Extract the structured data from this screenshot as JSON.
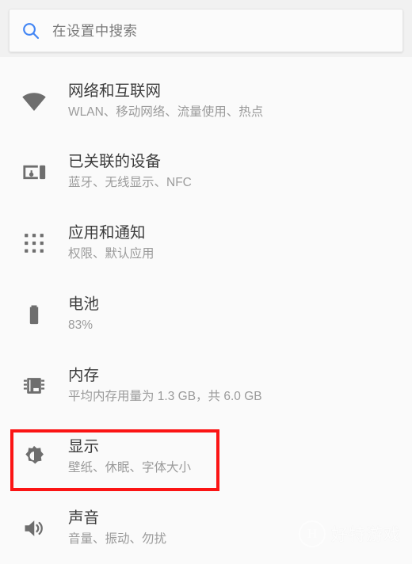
{
  "search": {
    "placeholder": "在设置中搜索",
    "icon": "search-icon",
    "icon_color": "#4285f4"
  },
  "settings_list": [
    {
      "id": "network",
      "icon": "wifi-icon",
      "title": "网络和互联网",
      "subtitle": "WLAN、移动网络、流量使用、热点"
    },
    {
      "id": "devices",
      "icon": "connected-devices-icon",
      "title": "已关联的设备",
      "subtitle": "蓝牙、无线显示、NFC"
    },
    {
      "id": "apps",
      "icon": "apps-grid-icon",
      "title": "应用和通知",
      "subtitle": "权限、默认应用"
    },
    {
      "id": "battery",
      "icon": "battery-icon",
      "title": "电池",
      "subtitle": "83%"
    },
    {
      "id": "memory",
      "icon": "memory-chip-icon",
      "title": "内存",
      "subtitle": "平均内存用量为 1.3 GB，共 6.0 GB"
    },
    {
      "id": "display",
      "icon": "brightness-icon",
      "title": "显示",
      "subtitle": "壁纸、休眠、字体大小"
    },
    {
      "id": "sound",
      "icon": "speaker-icon",
      "title": "声音",
      "subtitle": "音量、振动、勿扰"
    }
  ],
  "annotation": {
    "target": "display",
    "color": "#fb1414",
    "shape": "rectangle"
  },
  "watermark": {
    "logo_letter": "H",
    "text": "好特游戏"
  },
  "colors": {
    "background": "#fafafa",
    "search_background": "#f1f1f1",
    "title_text": "#3c3c3c",
    "subtitle_text": "#9b9b9b",
    "icon_gray": "#6e6e6e",
    "accent_blue": "#4285f4",
    "annotation_red": "#fb1414"
  }
}
